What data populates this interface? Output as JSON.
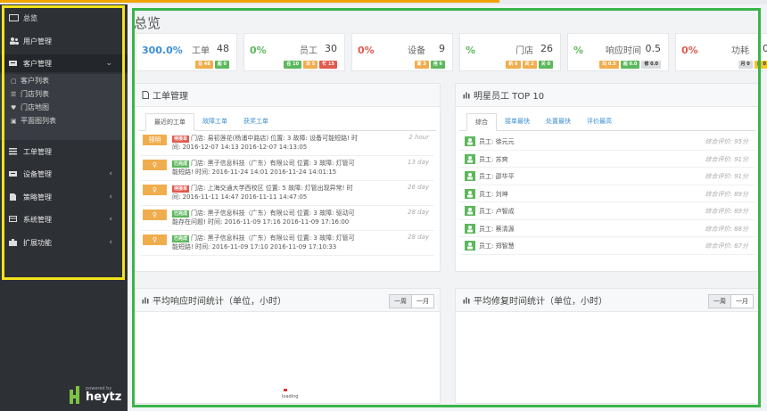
{
  "sidebar": {
    "top": {
      "label": "总览",
      "icon": "dashboard-icon"
    },
    "items": [
      {
        "label": "用户管理",
        "icon": "users-icon"
      },
      {
        "label": "客户管理",
        "icon": "customer-icon",
        "expanded": true
      },
      {
        "label": "工单管理",
        "icon": "list-icon"
      },
      {
        "label": "设备管理",
        "icon": "device-icon"
      },
      {
        "label": "策略管理",
        "icon": "policy-icon"
      },
      {
        "label": "系统管理",
        "icon": "system-icon"
      },
      {
        "label": "扩展功能",
        "icon": "extension-icon"
      }
    ],
    "sub_items": [
      {
        "label": "客户列表",
        "icon": "file-icon"
      },
      {
        "label": "门店列表",
        "icon": "list-icon"
      },
      {
        "label": "门店地图",
        "icon": "map-pin-icon"
      },
      {
        "label": "平面图列表",
        "icon": "image-icon"
      }
    ],
    "brand": {
      "powered": "powered by",
      "name": "heytz"
    }
  },
  "page": {
    "title": "总览"
  },
  "stats": [
    {
      "pct": "300.0%",
      "pct_color": "#3a8ed4",
      "label": "工单",
      "value": "48",
      "badges": [
        {
          "t": "处 48",
          "c": "b-orange"
        },
        {
          "t": "超 0",
          "c": "b-green"
        }
      ]
    },
    {
      "pct": "0%",
      "pct_color": "#5cb85c",
      "label": "员工",
      "value": "30",
      "badges": [
        {
          "t": "在 10",
          "c": "b-green"
        },
        {
          "t": "未 5",
          "c": "b-orange"
        },
        {
          "t": "忙 15",
          "c": "b-red"
        }
      ]
    },
    {
      "pct": "0%",
      "pct_color": "#e05a4e",
      "label": "设备",
      "value": "9",
      "badges": [
        {
          "t": "离 3",
          "c": "b-orange"
        },
        {
          "t": "用 6",
          "c": "b-green"
        }
      ]
    },
    {
      "pct": "%",
      "pct_color": "#5cb85c",
      "label": "门店",
      "value": "26",
      "badges": [
        {
          "t": "新 6",
          "c": "b-orange"
        },
        {
          "t": "闭 2",
          "c": "b-orange"
        },
        {
          "t": "关 0",
          "c": "b-green"
        }
      ]
    },
    {
      "pct": "%",
      "pct_color": "#5cb85c",
      "label": "响应时间",
      "value": "0.5",
      "badges": [
        {
          "t": "均 0.5",
          "c": "b-orange"
        },
        {
          "t": "超 0.0",
          "c": "b-green"
        },
        {
          "t": "修 0.0",
          "c": "b-gray"
        }
      ]
    },
    {
      "pct": "0%",
      "pct_color": "#e05a4e",
      "label": "功耗",
      "value": "0",
      "badges": [
        {
          "t": "月 0",
          "c": "b-gray"
        },
        {
          "t": "日 0",
          "c": "b-yellow"
        }
      ]
    }
  ],
  "work_orders": {
    "title": "工单管理",
    "tabs": [
      "最近的工单",
      "故障工单",
      "获奖工单"
    ],
    "items": [
      {
        "tag": "预明",
        "status": "待接单",
        "status_color": "#e05a4e",
        "line1": "门店: 易初莲花(杨浦中路店) 位置: 3 故障: 设备可能短路! 时",
        "line2": "间: 2016-12-07 14:13 2016-12-07 14:13:05",
        "ago": "2 hour"
      },
      {
        "tag": "♀",
        "status": "已完成",
        "status_color": "#5cb85c",
        "line1": "门店: 黑子信息科技（广东）有限公司 位置: 3 故障: 灯管可",
        "line2": "能短路! 时间: 2016-11-24 14:01 2016-11-24 14:01:15",
        "ago": "13 day"
      },
      {
        "tag": "♀",
        "status": "待接单",
        "status_color": "#e05a4e",
        "line1": "门店: 上海交通大学西校区 位置: 5 故障: 灯管出现异常! 时",
        "line2": "间: 2016-11-11 14:47 2016-11-11 14:47:05",
        "ago": "26 day"
      },
      {
        "tag": "♀",
        "status": "已完成",
        "status_color": "#5cb85c",
        "line1": "门店: 黑子信息科技（广东）有限公司 位置: 3 故障: 驱动可",
        "line2": "能存在问题! 时间: 2016-11-09 17:16 2016-11-09 17:16:00",
        "ago": "28 day"
      },
      {
        "tag": "♀",
        "status": "已完成",
        "status_color": "#5cb85c",
        "line1": "门店: 黑子信息科技（广东）有限公司 位置: 3 故障: 灯管可",
        "line2": "能短路! 时间: 2016-11-09 17:10 2016-11-09 17:10:33",
        "ago": "28 day"
      }
    ]
  },
  "top_staff": {
    "title": "明星员工 TOP 10",
    "tabs": [
      "综合",
      "接单最快",
      "处置最快",
      "评价最高"
    ],
    "items": [
      {
        "name": "员工: 徐元元",
        "score": "综合评价: 95分"
      },
      {
        "name": "员工: 苏爽",
        "score": "综合评价: 91分"
      },
      {
        "name": "员工: 邵华平",
        "score": "综合评价: 91分"
      },
      {
        "name": "员工: 刘坤",
        "score": "综合评价: 89分"
      },
      {
        "name": "员工: 卢智成",
        "score": "综合评价: 89分"
      },
      {
        "name": "员工: 蔡清源",
        "score": "综合评价: 88分"
      },
      {
        "name": "员工: 郑智慧",
        "score": "综合评价: 87分"
      }
    ]
  },
  "response_chart": {
    "title": "平均响应时间统计（单位，小时）",
    "week": "一周",
    "month": "一月",
    "loading": "loading"
  },
  "repair_chart": {
    "title": "平均修复时间统计（单位，小时）",
    "week": "一周",
    "month": "一月"
  }
}
